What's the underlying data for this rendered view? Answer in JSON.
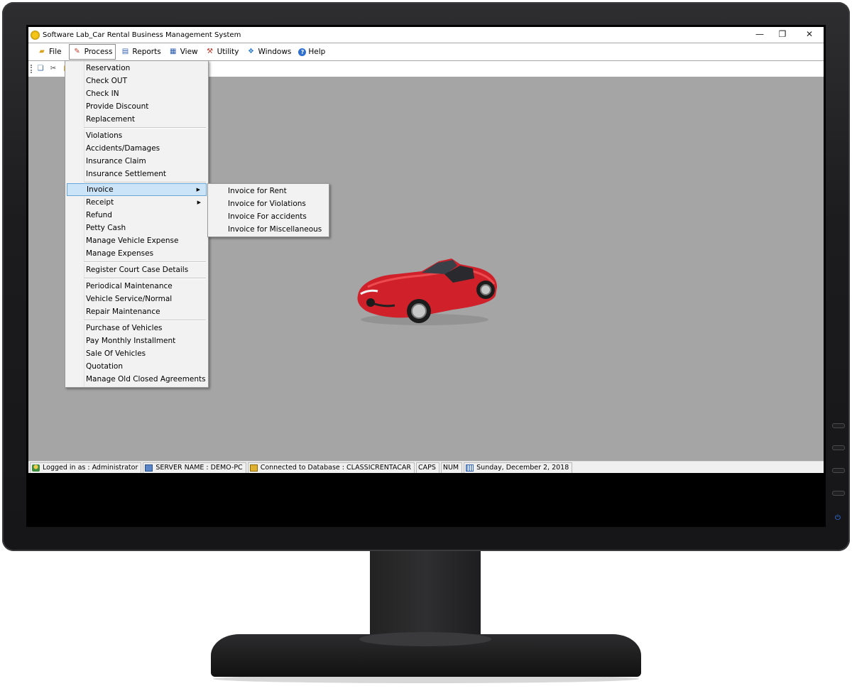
{
  "window": {
    "title": "Software Lab_Car Rental Business Management System",
    "controls": {
      "minimize": "—",
      "restore": "❐",
      "close": "✕"
    }
  },
  "menubar": [
    {
      "label": "File",
      "icon": "folder-open-icon"
    },
    {
      "label": "Process",
      "icon": "process-icon"
    },
    {
      "label": "Reports",
      "icon": "report-icon"
    },
    {
      "label": "View",
      "icon": "view-icon"
    },
    {
      "label": "Utility",
      "icon": "wrench-icon"
    },
    {
      "label": "Windows",
      "icon": "windows-icon"
    },
    {
      "label": "Help",
      "icon": "help-icon"
    }
  ],
  "process_menu": {
    "groups": [
      [
        "Reservation",
        "Check OUT",
        "Check IN",
        "Provide Discount",
        "Replacement"
      ],
      [
        "Violations",
        "Accidents/Damages",
        "Insurance Claim",
        "Insurance Settlement"
      ],
      [
        "Invoice",
        "Receipt",
        "Refund",
        "Petty Cash",
        "Manage Vehicle Expense",
        "Manage Expenses"
      ],
      [
        "Register Court Case Details"
      ],
      [
        "Periodical Maintenance",
        "Vehicle Service/Normal",
        "Repair Maintenance"
      ],
      [
        "Purchase  of Vehicles",
        "Pay Monthly Installment",
        "Sale Of Vehicles",
        "Quotation",
        "Manage Old Closed Agreements"
      ]
    ],
    "highlighted": "Invoice"
  },
  "invoice_submenu": [
    "Invoice for Rent",
    "Invoice for Violations",
    "Invoice For accidents",
    "Invoice for Miscellaneous"
  ],
  "statusbar": {
    "logged_in": "Logged in as : Administrator",
    "server": "SERVER NAME : DEMO-PC",
    "database": "Connected to Database : CLASSICRENTACAR",
    "caps": "CAPS",
    "num": "NUM",
    "date": "Sunday, December 2, 2018"
  },
  "colors": {
    "mdi_background": "#a5a5a5",
    "menu_highlight": "#cce4f7",
    "car_body": "#d0202a"
  }
}
